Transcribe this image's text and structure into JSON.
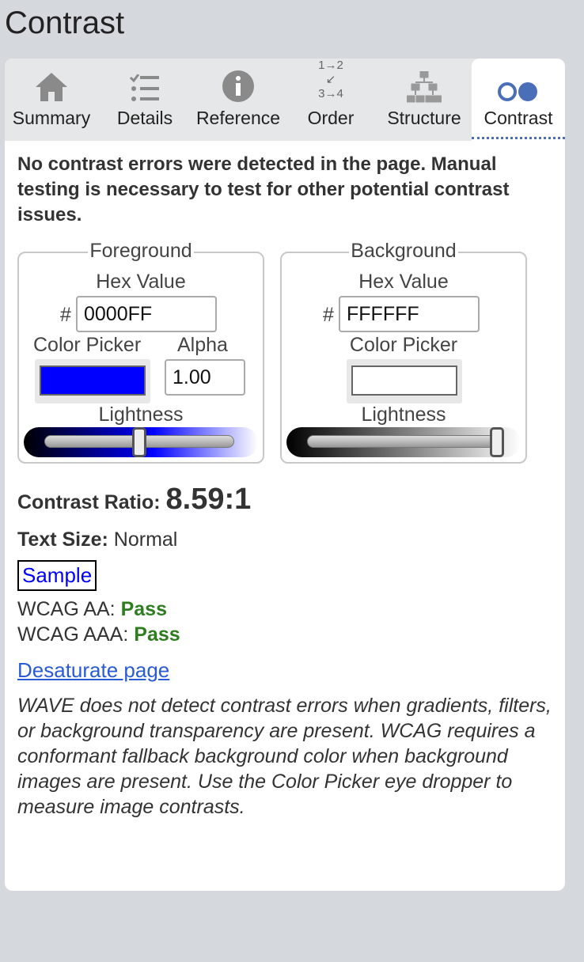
{
  "title": "Contrast",
  "tabs": [
    {
      "label": "Summary",
      "icon": "home-icon"
    },
    {
      "label": "Details",
      "icon": "list-icon"
    },
    {
      "label": "Reference",
      "icon": "info-icon"
    },
    {
      "label": "Order",
      "icon": "order-icon",
      "glyph_top": "1→2",
      "glyph_bottom": "3→4"
    },
    {
      "label": "Structure",
      "icon": "structure-icon"
    },
    {
      "label": "Contrast",
      "icon": "contrast-icon",
      "active": true
    }
  ],
  "status_message": "No contrast errors were detected in the page. Manual testing is necessary to test for other potential contrast issues.",
  "foreground": {
    "legend": "Foreground",
    "hex_label": "Hex Value",
    "hash": "#",
    "hex_value": "0000FF",
    "color_picker_label": "Color Picker",
    "alpha_label": "Alpha",
    "alpha_value": "1.00",
    "lightness_label": "Lightness",
    "lightness": 0.5,
    "color": "#0000FF"
  },
  "background": {
    "legend": "Background",
    "hex_label": "Hex Value",
    "hash": "#",
    "hex_value": "FFFFFF",
    "color_picker_label": "Color Picker",
    "lightness_label": "Lightness",
    "lightness": 1.0,
    "color": "#FFFFFF"
  },
  "contrast_ratio_label": "Contrast Ratio:",
  "contrast_ratio_value": "8.59:1",
  "text_size_label": "Text Size:",
  "text_size_value": "Normal",
  "sample_text": "Sample",
  "wcag_aa_label": "WCAG AA:",
  "wcag_aa_result": "Pass",
  "wcag_aaa_label": "WCAG AAA:",
  "wcag_aaa_result": "Pass",
  "desaturate_link": "Desaturate page",
  "note": "WAVE does not detect contrast errors when gradients, filters, or background transparency are present. WCAG requires a conformant fallback background color when background images are present. Use the Color Picker eye dropper to measure image contrasts.",
  "colors": {
    "accent": "#4a6fb8",
    "pass": "#2e7d1f",
    "link": "#2a5bd7"
  }
}
